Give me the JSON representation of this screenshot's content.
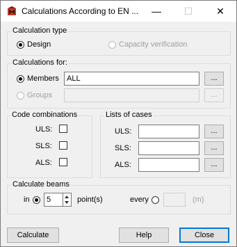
{
  "window": {
    "title": "Calculations According to EN ...",
    "minimize": "—",
    "maximize": "☐",
    "close": "✕"
  },
  "calc_type": {
    "label": "Calculation type",
    "design": "Design",
    "capacity": "Capacity verification"
  },
  "calc_for": {
    "label": "Calculations for:",
    "members": "Members",
    "members_value": "ALL",
    "groups": "Groups",
    "groups_value": "",
    "browse": "..."
  },
  "code_combinations": {
    "label": "Code combinations",
    "uls": "ULS:",
    "sls": "SLS:",
    "als": "ALS:"
  },
  "lists_of_cases": {
    "label": "Lists of cases",
    "uls": "ULS:",
    "sls": "SLS:",
    "als": "ALS:",
    "uls_value": "",
    "sls_value": "",
    "als_value": "",
    "browse": "..."
  },
  "calculate_beams": {
    "label": "Calculate beams",
    "in": "in",
    "points_value": "5",
    "points_label": "point(s)",
    "every": "every",
    "every_value": "",
    "unit": "(m)"
  },
  "buttons": {
    "calculate": "Calculate",
    "help": "Help",
    "close": "Close"
  }
}
